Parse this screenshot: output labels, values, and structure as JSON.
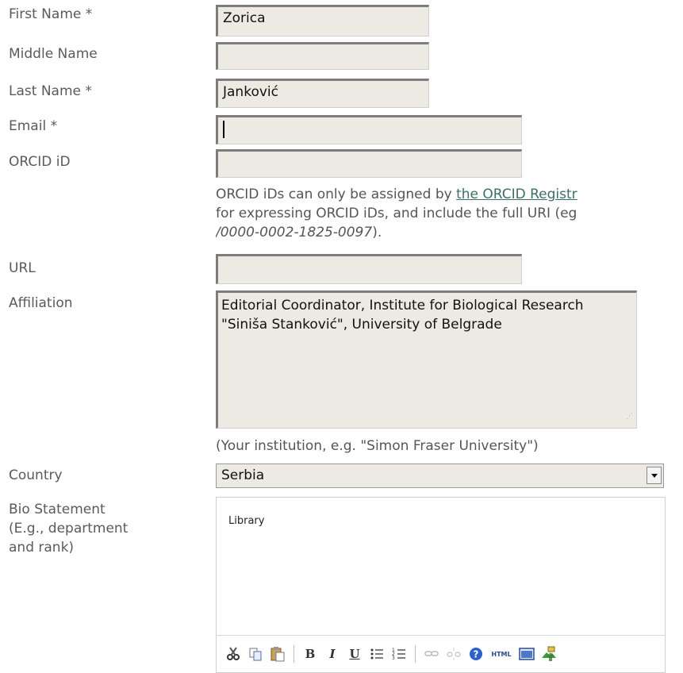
{
  "form": {
    "first_name": {
      "label": "First Name *",
      "value": "Zorica"
    },
    "middle_name": {
      "label": "Middle Name",
      "value": ""
    },
    "last_name": {
      "label": "Last Name *",
      "value": "Janković"
    },
    "email": {
      "label": "Email *",
      "value": ""
    },
    "orcid": {
      "label": "ORCID iD",
      "value": "",
      "help_line1_pre": "ORCID iDs can only be assigned by ",
      "help_link": "the ORCID Registr",
      "help_line2": "for expressing ORCID iDs, and include the full URI (eg",
      "help_line3_italic": "/0000-0002-1825-0097",
      "help_line3_end": ")."
    },
    "url": {
      "label": "URL",
      "value": ""
    },
    "affiliation": {
      "label": "Affiliation",
      "value": "Editorial Coordinator, Institute for Biological Research \"Siniša Stanković\", University of Belgrade",
      "help": "(Your institution, e.g. \"Simon Fraser University\")"
    },
    "country": {
      "label": "Country",
      "value": "Serbia"
    },
    "bio": {
      "label_line1": "Bio Statement",
      "label_line2": "(E.g., department",
      "label_line3": "and rank)",
      "value": "Library"
    }
  },
  "toolbar": {
    "icons": [
      "cut-icon",
      "copy-icon",
      "paste-icon",
      "bold-icon",
      "italic-icon",
      "underline-icon",
      "bullet-list-icon",
      "numbered-list-icon",
      "link-icon",
      "unlink-icon",
      "help-icon",
      "html-icon",
      "fullscreen-icon",
      "image-icon"
    ],
    "bold": "B",
    "italic": "I",
    "underline": "U",
    "html": "HTML"
  },
  "colors": {
    "field_bg": "#eceae3",
    "link": "#3c6e64",
    "help_icon": "#2a62c9"
  }
}
